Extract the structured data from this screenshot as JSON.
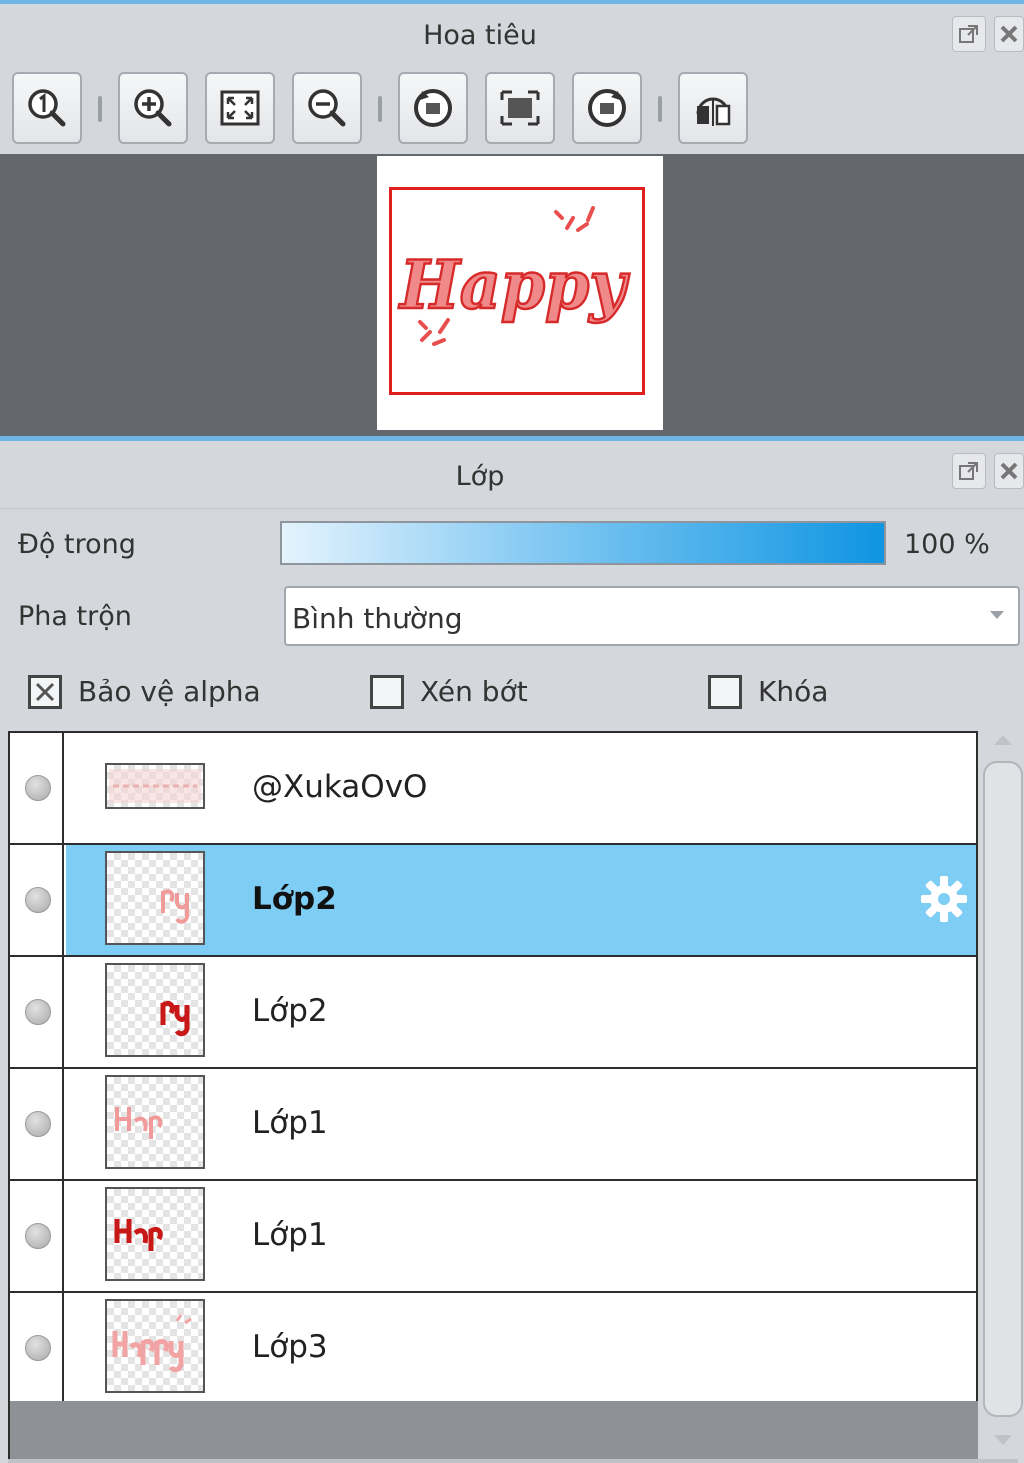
{
  "navigator": {
    "title": "Hoa tiêu",
    "toolbar": [
      {
        "name": "zoom-actual-button",
        "icon": "zoom-one-icon"
      },
      {
        "name": "zoom-in-button",
        "icon": "zoom-in-icon"
      },
      {
        "name": "fit-window-button",
        "icon": "fit-window-icon"
      },
      {
        "name": "zoom-out-button",
        "icon": "zoom-out-icon"
      },
      {
        "name": "rotate-left-button",
        "icon": "rotate-left-icon"
      },
      {
        "name": "reset-view-button",
        "icon": "reset-view-icon"
      },
      {
        "name": "rotate-right-button",
        "icon": "rotate-right-icon"
      },
      {
        "name": "flip-horizontal-button",
        "icon": "flip-horizontal-icon"
      }
    ],
    "preview_text": "Happy"
  },
  "layers_panel": {
    "title": "Lớp",
    "opacity_label": "Độ trong",
    "opacity_value": "100 %",
    "opacity_fraction": 1.0,
    "blend_label": "Pha trộn",
    "blend_value": "Bình thường",
    "checkboxes": [
      {
        "label": "Bảo vệ alpha",
        "checked": true
      },
      {
        "label": "Xén bớt",
        "checked": false
      },
      {
        "label": "Khóa",
        "checked": false
      }
    ],
    "layers": [
      {
        "name": "@XukaOvO",
        "selected": false,
        "thumb": "watermark"
      },
      {
        "name": "Lớp2",
        "selected": true,
        "thumb": "py-light"
      },
      {
        "name": "Lớp2",
        "selected": false,
        "thumb": "py-dark"
      },
      {
        "name": "Lớp1",
        "selected": false,
        "thumb": "hap-light"
      },
      {
        "name": "Lớp1",
        "selected": false,
        "thumb": "hap-dark"
      },
      {
        "name": "Lớp3",
        "selected": false,
        "thumb": "happy-full"
      }
    ]
  },
  "colors": {
    "accent": "#6fb6e6",
    "selection": "#7ecdf5",
    "art_red": "#e01f1f"
  }
}
